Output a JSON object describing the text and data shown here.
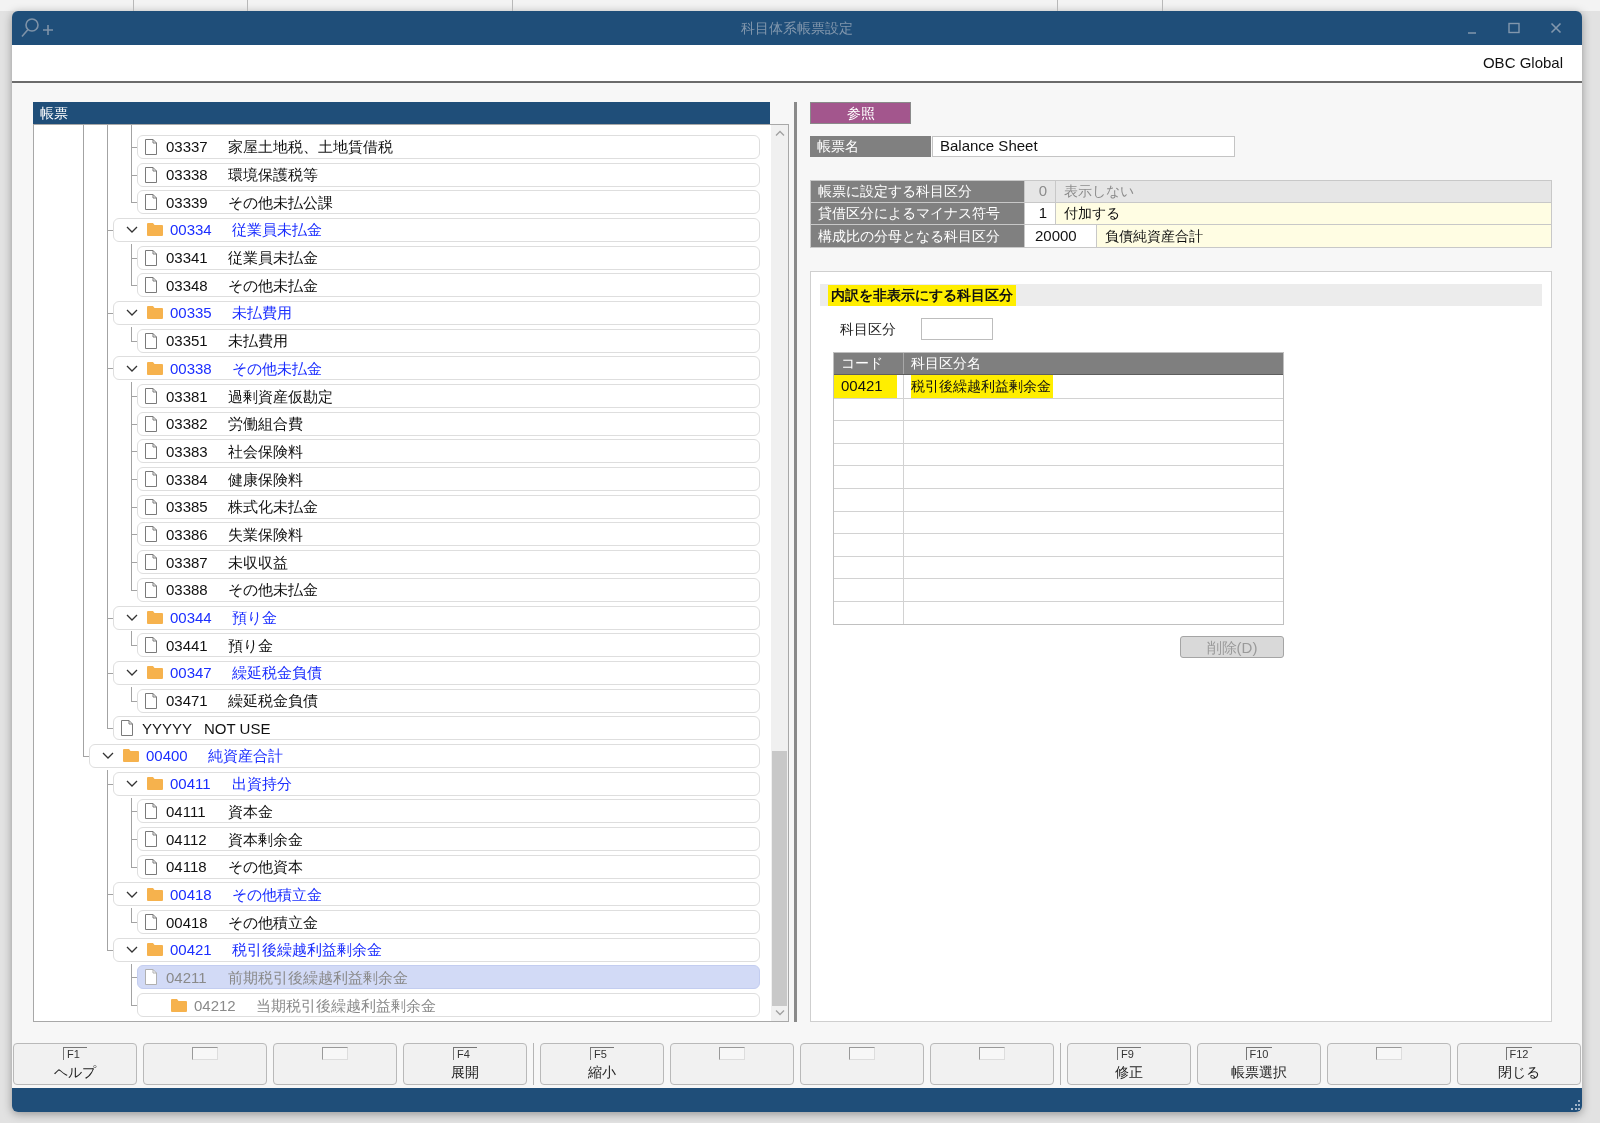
{
  "window": {
    "title": "科目体系帳票設定"
  },
  "header": {
    "company": "OBC Global"
  },
  "tree": {
    "title": "帳票",
    "items": [
      {
        "children": [
          {
            "children": [
              {
                "kind": "account",
                "code": "03337",
                "name": "家屋土地税、土地賃借税",
                "selected": false,
                "disabled": false
              },
              {
                "kind": "account",
                "code": "03338",
                "name": "環境保護税等",
                "selected": false,
                "disabled": false
              },
              {
                "kind": "account",
                "code": "03339",
                "name": "その他未払公課",
                "selected": false,
                "disabled": false
              }
            ]
          },
          {
            "kind": "folder",
            "code": "00334",
            "name": "従業員未払金",
            "expanded": true,
            "selected": false,
            "disabled": false,
            "children": [
              {
                "kind": "account",
                "code": "03341",
                "name": "従業員未払金",
                "selected": false,
                "disabled": false
              },
              {
                "kind": "account",
                "code": "03348",
                "name": "その他未払金",
                "selected": false,
                "disabled": false
              }
            ]
          },
          {
            "kind": "folder",
            "code": "00335",
            "name": "未払費用",
            "expanded": true,
            "selected": false,
            "disabled": false,
            "children": [
              {
                "kind": "account",
                "code": "03351",
                "name": "未払費用",
                "selected": false,
                "disabled": false
              }
            ]
          },
          {
            "kind": "folder",
            "code": "00338",
            "name": "その他未払金",
            "expanded": true,
            "selected": false,
            "disabled": false,
            "children": [
              {
                "kind": "account",
                "code": "03381",
                "name": "過剰資産仮勘定",
                "selected": false,
                "disabled": false
              },
              {
                "kind": "account",
                "code": "03382",
                "name": "労働組合費",
                "selected": false,
                "disabled": false
              },
              {
                "kind": "account",
                "code": "03383",
                "name": "社会保険料",
                "selected": false,
                "disabled": false
              },
              {
                "kind": "account",
                "code": "03384",
                "name": "健康保険料",
                "selected": false,
                "disabled": false
              },
              {
                "kind": "account",
                "code": "03385",
                "name": "株式化未払金",
                "selected": false,
                "disabled": false
              },
              {
                "kind": "account",
                "code": "03386",
                "name": "失業保険料",
                "selected": false,
                "disabled": false
              },
              {
                "kind": "account",
                "code": "03387",
                "name": "未収収益",
                "selected": false,
                "disabled": false
              },
              {
                "kind": "account",
                "code": "03388",
                "name": "その他未払金",
                "selected": false,
                "disabled": false
              }
            ]
          },
          {
            "kind": "folder",
            "code": "00344",
            "name": "預り金",
            "expanded": true,
            "selected": false,
            "disabled": false,
            "children": [
              {
                "kind": "account",
                "code": "03441",
                "name": "預り金",
                "selected": false,
                "disabled": false
              }
            ]
          },
          {
            "kind": "folder",
            "code": "00347",
            "name": "繰延税金負債",
            "expanded": true,
            "selected": false,
            "disabled": false,
            "children": [
              {
                "kind": "account",
                "code": "03471",
                "name": "繰延税金負債",
                "selected": false,
                "disabled": false
              }
            ]
          },
          {
            "kind": "account",
            "code": "YYYYY",
            "name": "NOT USE",
            "selected": false,
            "disabled": false
          }
        ]
      },
      {
        "kind": "folder",
        "code": "00400",
        "name": "純資産合計",
        "expanded": true,
        "selected": false,
        "disabled": false,
        "children": [
          {
            "kind": "folder",
            "code": "00411",
            "name": "出資持分",
            "expanded": true,
            "selected": false,
            "disabled": false,
            "children": [
              {
                "kind": "account",
                "code": "04111",
                "name": "資本金",
                "selected": false,
                "disabled": false
              },
              {
                "kind": "account",
                "code": "04112",
                "name": "資本剰余金",
                "selected": false,
                "disabled": false
              },
              {
                "kind": "account",
                "code": "04118",
                "name": "その他資本",
                "selected": false,
                "disabled": false
              }
            ]
          },
          {
            "kind": "folder",
            "code": "00418",
            "name": "その他積立金",
            "expanded": true,
            "selected": false,
            "disabled": false,
            "children": [
              {
                "kind": "account",
                "code": "00418",
                "name": "その他積立金",
                "selected": false,
                "disabled": false
              }
            ]
          },
          {
            "kind": "folder",
            "code": "00421",
            "name": "税引後繰越利益剰余金",
            "expanded": true,
            "selected": false,
            "disabled": false,
            "children": [
              {
                "kind": "account",
                "code": "04211",
                "name": "前期税引後繰越利益剰余金",
                "selected": true,
                "disabled": true
              },
              {
                "kind": "folder",
                "code": "04212",
                "name": "当期税引後繰越利益剰余金",
                "selected": false,
                "disabled": true
              }
            ]
          }
        ]
      }
    ]
  },
  "reference_button": {
    "label": "参照"
  },
  "report_name": {
    "label": "帳票名",
    "value": "Balance Sheet"
  },
  "settings": [
    {
      "kind": "option",
      "label": "帳票に設定する科目区分",
      "code": "0",
      "name": "表示しない",
      "disabled": true
    },
    {
      "kind": "option",
      "label": "貸借区分によるマイナス符号",
      "code": "1",
      "name": "付加する",
      "disabled": false
    },
    {
      "kind": "account",
      "label": "構成比の分母となる科目区分",
      "code": "20000",
      "name": "負債純資産合計",
      "disabled": false
    }
  ],
  "hidden_breakdown": {
    "title": "内訳を非表示にする科目区分",
    "highlighted": true,
    "field": {
      "label": "科目区分"
    },
    "table": {
      "columns": [
        "コード",
        "科目区分名"
      ],
      "rows": [
        {
          "code": "00421",
          "name": "税引後繰越利益剰余金",
          "highlighted": true
        }
      ]
    },
    "delete_button": {
      "label": "削除(D)",
      "disabled": true
    }
  },
  "function_keys": [
    [
      {
        "kind": "key",
        "key": "F1",
        "label": "ヘルプ"
      },
      {
        "kind": "blank"
      },
      {
        "kind": "blank"
      },
      {
        "kind": "key",
        "key": "F4",
        "label": "展開"
      }
    ],
    [
      {
        "kind": "key",
        "key": "F5",
        "label": "縮小"
      },
      {
        "kind": "blank"
      },
      {
        "kind": "blank"
      },
      {
        "kind": "blank"
      }
    ],
    [
      {
        "kind": "key",
        "key": "F9",
        "label": "修正"
      },
      {
        "kind": "key",
        "key": "F10",
        "label": "帳票選択"
      },
      {
        "kind": "blank"
      },
      {
        "kind": "key",
        "key": "F12",
        "label": "閉じる"
      }
    ]
  ]
}
